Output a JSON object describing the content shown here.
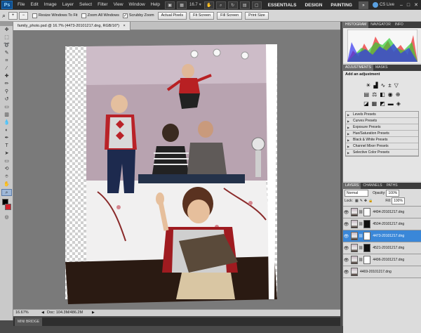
{
  "menu": {
    "app_icon": "Ps",
    "items": [
      "File",
      "Edit",
      "Image",
      "Layer",
      "Select",
      "Filter",
      "View",
      "Window",
      "Help"
    ],
    "zoom": "16.7",
    "workspaces": [
      "ESSENTIALS",
      "DESIGN",
      "PAINTING"
    ],
    "more": "»",
    "cs_live": "CS Live"
  },
  "options": {
    "resize_windows": "Resize Windows To Fit",
    "zoom_all": "Zoom All Windows",
    "scrubby_zoom": "Scrubby Zoom",
    "actual_pixels": "Actual Pixels",
    "fit_screen": "Fit Screen",
    "fill_screen": "Fill Screen",
    "print_size": "Print Size"
  },
  "document": {
    "tab_title": "family_photo.psd @ 16.7% (4473-20101217.dng, RGB/16*)",
    "zoom_status": "16.67%",
    "doc_size": "Doc: 104.3M/486.2M"
  },
  "mini_bridge": "MINI BRIDGE",
  "panels": {
    "histogram_tabs": [
      "HISTOGRAM",
      "NAVIGATOR",
      "INFO"
    ],
    "adjustments_tabs": [
      "ADJUSTMENTS",
      "MASKS"
    ],
    "add_adjustment": "Add an adjustment",
    "presets": [
      "Levels Presets",
      "Curves Presets",
      "Exposure Presets",
      "Hue/Saturation Presets",
      "Black & White Presets",
      "Channel Mixer Presets",
      "Selective Color Presets"
    ],
    "layers_tabs": [
      "LAYERS",
      "CHANNELS",
      "PATHS"
    ],
    "blend_mode": "Normal",
    "opacity_label": "Opacity:",
    "opacity_value": "100%",
    "lock_label": "Lock:",
    "fill_label": "Fill:",
    "fill_value": "100%",
    "layers": [
      {
        "name": "4494-20101217.dng"
      },
      {
        "name": "4504-20101217.dng"
      },
      {
        "name": "4473-20101217.dng"
      },
      {
        "name": "4521-20101217.dng"
      },
      {
        "name": "4496-20101217.dng"
      },
      {
        "name": "4469-20101217.dng"
      }
    ]
  },
  "colors": {
    "accent": "#3a87d8",
    "foreground": "#000000",
    "background": "#d21f2a"
  }
}
